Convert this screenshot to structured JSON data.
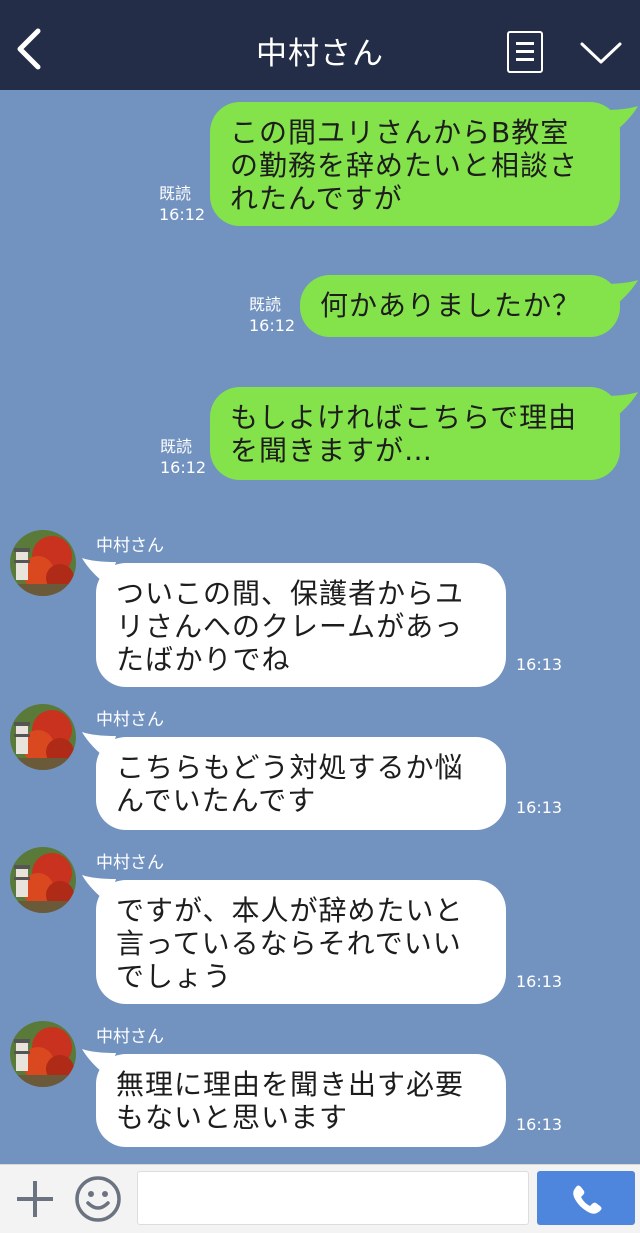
{
  "header": {
    "title": "中村さん",
    "back_icon": "chevron-left-icon",
    "menu_icon": "notes-icon",
    "collapse_icon": "chevron-down-icon",
    "background_color": "#232d47"
  },
  "colors": {
    "chat_background": "#7293c0",
    "outgoing_bubble": "#84e34b",
    "incoming_bubble": "#ffffff",
    "call_button": "#4e86dd"
  },
  "messages": [
    {
      "direction": "outgoing",
      "text": "この間ユリさんからB教室\nの勤務を辞めたいと相談さ\nれたんですが",
      "read_label": "既読",
      "time": "16:12"
    },
    {
      "direction": "outgoing",
      "text": "何かありましたか？",
      "read_label": "既読",
      "time": "16:12"
    },
    {
      "direction": "outgoing",
      "text": "もしよければこちらで理由\nを聞きますが…",
      "read_label": "既読",
      "time": "16:12"
    },
    {
      "direction": "incoming",
      "sender": "中村さん",
      "text": "ついこの間、保護者からユ\nリさんへのクレームがあっ\nたばかりでね",
      "time": "16:13"
    },
    {
      "direction": "incoming",
      "sender": "中村さん",
      "text": "こちらもどう対処するか悩\nんでいたんです",
      "time": "16:13"
    },
    {
      "direction": "incoming",
      "sender": "中村さん",
      "text": "ですが、本人が辞めたいと\n言っているならそれでいい\nでしょう",
      "time": "16:13"
    },
    {
      "direction": "incoming",
      "sender": "中村さん",
      "text": "無理に理由を聞き出す必要\nもないと思います",
      "time": "16:13"
    }
  ],
  "input_bar": {
    "plus_icon": "plus-icon",
    "emoji_icon": "smiley-icon",
    "message_placeholder": "",
    "call_icon": "phone-icon"
  }
}
